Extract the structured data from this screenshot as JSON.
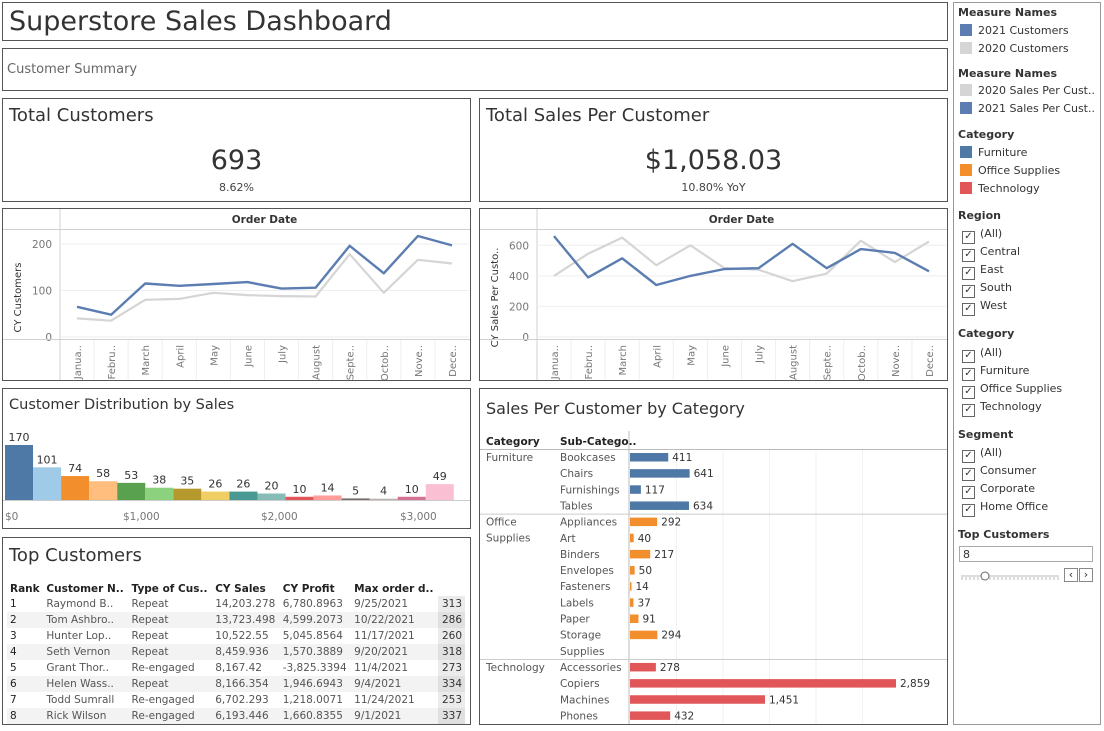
{
  "title": "Superstore Sales Dashboard",
  "subtitle": "Customer Summary",
  "total_customers": {
    "title": "Total Customers",
    "value": "693",
    "change": "8.62%"
  },
  "sales_per_customer": {
    "title": "Total Sales Per Customer",
    "value": "$1,058.03",
    "change": "10.80% YoY"
  },
  "month_labels": [
    "Janua..",
    "Febru..",
    "March",
    "April",
    "May",
    "June",
    "July",
    "August",
    "Septe..",
    "Octob..",
    "Nove..",
    "Dece.."
  ],
  "colors": {
    "cy": "#5b7db1",
    "py": "#d5d5d5",
    "furniture": "#4e79a7",
    "office": "#f28e2b",
    "technology": "#e15759"
  },
  "chart_data": [
    {
      "type": "line",
      "header": "Order Date",
      "ylabel": "CY Customers",
      "ylim": [
        0,
        230
      ],
      "yticks": [
        "0",
        "100",
        "200"
      ],
      "x": [
        "Janua..",
        "Febru..",
        "March",
        "April",
        "May",
        "June",
        "July",
        "August",
        "Septe..",
        "Octob..",
        "Nove..",
        "Dece.."
      ],
      "series": [
        {
          "name": "2021 Customers",
          "values": [
            65,
            48,
            115,
            110,
            114,
            118,
            104,
            106,
            196,
            137,
            217,
            197
          ]
        },
        {
          "name": "2020 Customers",
          "values": [
            40,
            35,
            80,
            82,
            95,
            90,
            88,
            87,
            178,
            95,
            166,
            158
          ]
        }
      ]
    },
    {
      "type": "line",
      "header": "Order Date",
      "ylabel": "CY Sales Per Custo..",
      "ylim": [
        0,
        700
      ],
      "yticks": [
        "0",
        "200",
        "400",
        "600"
      ],
      "x": [
        "Janua..",
        "Febru..",
        "March",
        "April",
        "May",
        "June",
        "July",
        "August",
        "Septe..",
        "Octob..",
        "Nove..",
        "Dece.."
      ],
      "series": [
        {
          "name": "2021 Sales Per Cust..",
          "values": [
            660,
            390,
            515,
            340,
            400,
            445,
            450,
            610,
            450,
            575,
            550,
            430
          ]
        },
        {
          "name": "2020 Sales Per Cust..",
          "values": [
            400,
            545,
            650,
            470,
            600,
            450,
            440,
            365,
            415,
            630,
            490,
            625
          ]
        }
      ]
    },
    {
      "type": "bar",
      "title": "Customer Distribution by Sales",
      "values": [
        170,
        101,
        74,
        58,
        53,
        38,
        35,
        26,
        26,
        20,
        10,
        14,
        5,
        4,
        10,
        49
      ],
      "bar_colors": [
        "#4e79a7",
        "#a0cbe8",
        "#f28e2b",
        "#ffbe7d",
        "#59a14f",
        "#8cd17d",
        "#b6992d",
        "#f1ce63",
        "#499894",
        "#86bcb6",
        "#e15759",
        "#ff9d9a",
        "#79706e",
        "#bab0ac",
        "#d37295",
        "#fabfd2"
      ],
      "xticks": [
        "$0",
        "$1,000",
        "$2,000",
        "$3,000"
      ]
    },
    {
      "type": "bar",
      "title": "Sales Per Customer by Category",
      "headers": [
        "Category",
        "Sub-Catego.."
      ],
      "groups": [
        {
          "category": "Furniture",
          "items": [
            {
              "name": "Bookcases",
              "value": 411
            },
            {
              "name": "Chairs",
              "value": 641
            },
            {
              "name": "Furnishings",
              "value": 117
            },
            {
              "name": "Tables",
              "value": 634
            }
          ]
        },
        {
          "category": "Office Supplies",
          "items": [
            {
              "name": "Appliances",
              "value": 292
            },
            {
              "name": "Art",
              "value": 40
            },
            {
              "name": "Binders",
              "value": 217
            },
            {
              "name": "Envelopes",
              "value": 50
            },
            {
              "name": "Fasteners",
              "value": 14
            },
            {
              "name": "Labels",
              "value": 37
            },
            {
              "name": "Paper",
              "value": 91
            },
            {
              "name": "Storage",
              "value": 294
            },
            {
              "name": "Supplies",
              "value": 0
            }
          ]
        },
        {
          "category": "Technology",
          "items": [
            {
              "name": "Accessories",
              "value": 278
            },
            {
              "name": "Copiers",
              "value": 2859
            },
            {
              "name": "Machines",
              "value": 1451
            },
            {
              "name": "Phones",
              "value": 432
            }
          ]
        }
      ]
    }
  ],
  "legends": {
    "measure1": {
      "title": "Measure Names",
      "items": [
        {
          "label": "2021 Customers",
          "color": "#5b7db1"
        },
        {
          "label": "2020 Customers",
          "color": "#d5d5d5"
        }
      ]
    },
    "measure2": {
      "title": "Measure Names",
      "items": [
        {
          "label": "2020 Sales Per Cust..",
          "color": "#d5d5d5"
        },
        {
          "label": "2021 Sales Per Cust..",
          "color": "#5b7db1"
        }
      ]
    },
    "category": {
      "title": "Category",
      "items": [
        {
          "label": "Furniture",
          "color": "#4e79a7"
        },
        {
          "label": "Office Supplies",
          "color": "#f28e2b"
        },
        {
          "label": "Technology",
          "color": "#e15759"
        }
      ]
    }
  },
  "filters": {
    "region": {
      "title": "Region",
      "options": [
        "(All)",
        "Central",
        "East",
        "South",
        "West"
      ]
    },
    "category": {
      "title": "Category",
      "options": [
        "(All)",
        "Furniture",
        "Office Supplies",
        "Technology"
      ]
    },
    "segment": {
      "title": "Segment",
      "options": [
        "(All)",
        "Consumer",
        "Corporate",
        "Home Office"
      ]
    },
    "check_mark": "✓"
  },
  "top_param": {
    "title": "Top Customers",
    "value": "8",
    "prev": "‹",
    "next": "›"
  },
  "top_customers": {
    "title": "Top Customers",
    "columns": [
      "Rank",
      "Customer N..",
      "Type of Cus..",
      "CY Sales",
      "CY Profit",
      "Max order d..",
      ""
    ],
    "rows": [
      [
        "1",
        "Raymond B..",
        "Repeat",
        "14,203.278",
        "6,780.8963",
        "9/25/2021",
        "313"
      ],
      [
        "2",
        "Tom Ashbro..",
        "Repeat",
        "13,723.498",
        "4,599.2073",
        "10/22/2021",
        "286"
      ],
      [
        "3",
        "Hunter Lop..",
        "Repeat",
        "10,522.55",
        "5,045.8564",
        "11/17/2021",
        "260"
      ],
      [
        "4",
        "Seth Vernon",
        "Repeat",
        "8,459.936",
        "1,570.3889",
        "9/20/2021",
        "318"
      ],
      [
        "5",
        "Grant Thor..",
        "Re-engaged",
        "8,167.42",
        "-3,825.3394",
        "11/4/2021",
        "273"
      ],
      [
        "6",
        "Helen Wass..",
        "Repeat",
        "8,166.354",
        "1,946.6943",
        "9/4/2021",
        "334"
      ],
      [
        "7",
        "Todd Sumrall",
        "Re-engaged",
        "6,702.293",
        "1,218.0071",
        "11/24/2021",
        "253"
      ],
      [
        "8",
        "Rick Wilson",
        "Re-engaged",
        "6,193.446",
        "1,660.8355",
        "9/1/2021",
        "337"
      ]
    ]
  }
}
